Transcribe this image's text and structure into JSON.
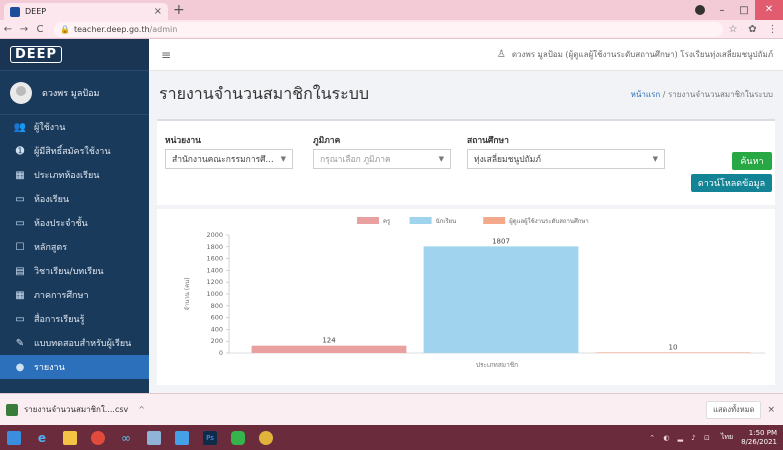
{
  "browser": {
    "tab_title": "DEEP",
    "close_glyph": "×",
    "new_tab_glyph": "+",
    "url_host": "teacher.deep.go.th",
    "url_path": "/admin"
  },
  "sidebar": {
    "logo": "DEEP",
    "user_name": "ดวงพร มูลป้อม",
    "items": [
      {
        "icon": "users-icon",
        "glyph": "👥",
        "label": "ผู้ใช้งาน"
      },
      {
        "icon": "user-plus-icon",
        "glyph": "➊",
        "label": "ผู้มีสิทธิ์สมัครใช้งาน"
      },
      {
        "icon": "table-icon",
        "glyph": "▦",
        "label": "ประเภทห้องเรียน"
      },
      {
        "icon": "classroom-icon",
        "glyph": "▭",
        "label": "ห้องเรียน"
      },
      {
        "icon": "homeroom-icon",
        "glyph": "▭",
        "label": "ห้องประจำชั้น"
      },
      {
        "icon": "curriculum-icon",
        "glyph": "☐",
        "label": "หลักสูตร"
      },
      {
        "icon": "subject-icon",
        "glyph": "▤",
        "label": "วิชาเรียน/บทเรียน"
      },
      {
        "icon": "calendar-icon",
        "glyph": "▦",
        "label": "ภาคการศึกษา"
      },
      {
        "icon": "media-icon",
        "glyph": "▭",
        "label": "สื่อการเรียนรู้"
      },
      {
        "icon": "test-icon",
        "glyph": "✎",
        "label": "แบบทดสอบสำหรับผู้เรียน"
      },
      {
        "icon": "report-icon",
        "glyph": "●",
        "label": "รายงาน"
      }
    ]
  },
  "header": {
    "menu_glyph": "≡",
    "user_text": "ดวงพร มูลป้อม (ผู้ดูแลผู้ใช้งานระดับสถานศึกษา) โรงเรียนทุ่งเสลี่ยมชนูปถัมภ์"
  },
  "page": {
    "title": "รายงานจำนวนสมาชิกในระบบ",
    "breadcrumb_home": "หน้าแรก",
    "breadcrumb_sep": "/",
    "breadcrumb_current": "รายงานจำนวนสมาชิกในระบบ"
  },
  "filters": {
    "agency_label": "หน่วยงาน",
    "agency_value": "สำนักงานคณะกรรมการศึ...",
    "region_label": "ภูมิภาค",
    "region_placeholder": "กรุณาเลือก ภูมิภาค",
    "school_label": "สถานศึกษา",
    "school_value": "ทุ่งเสลี่ยมชนูปถัมภ์",
    "search_button": "ค้นหา",
    "download_button": "ดาวน์โหลดข้อมูล"
  },
  "chart_data": {
    "type": "bar",
    "categories": [
      "ประเภทสมาชิก"
    ],
    "series": [
      {
        "name": "ครู",
        "values": [
          124
        ],
        "color": "#e8a0a0"
      },
      {
        "name": "นักเรียน",
        "values": [
          1807
        ],
        "color": "#9fd3ee"
      },
      {
        "name": "ผู้ดูแลผู้ใช้งานระดับสถานศึกษา",
        "values": [
          10
        ],
        "color": "#f4a98a"
      }
    ],
    "ylabel": "จำนวน (คน)",
    "ylim": [
      0,
      2000
    ],
    "yticks": [
      0,
      200,
      400,
      600,
      800,
      1000,
      1200,
      1400,
      1600,
      1800,
      2000
    ],
    "legend": "top",
    "grid": false
  },
  "downloads": {
    "file_name": "รายงานจำนวนสมาชิกใ....csv",
    "chevron": "^",
    "show_all": "แสดงทั้งหมด",
    "close": "×"
  },
  "taskbar": {
    "lang": "ไทย",
    "time": "1:50 PM",
    "date": "8/26/2021"
  }
}
